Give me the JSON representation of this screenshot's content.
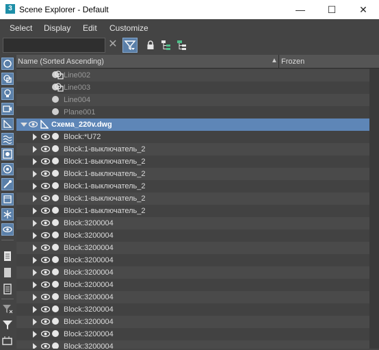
{
  "window": {
    "app_icon": "3",
    "title": "Scene Explorer - Default",
    "minimize": "—",
    "maximize": "☐",
    "close": "✕"
  },
  "menu": [
    "Select",
    "Display",
    "Edit",
    "Customize"
  ],
  "toolbar": {
    "search_value": "",
    "clear_symbol": "✕",
    "icons": [
      "filter-icon",
      "lock-icon",
      "hierarchy-icon",
      "collapse-hierarchy-icon"
    ]
  },
  "sidebar_icons": [
    "geometry-icon",
    "shape-icon",
    "light-icon",
    "camera-icon",
    "helper-icon",
    "spacewarp-icon",
    "group-icon",
    "xref-icon",
    "bone-icon",
    "container-icon",
    "frozen-icon",
    "hidden-icon",
    "display-all-icon",
    "display-none-icon",
    "invert-display-icon",
    "filter-funnel-x-icon",
    "filter-funnel-icon",
    "layer-icon"
  ],
  "columns": {
    "name": "Name (Sorted Ascending)",
    "sort_arrow": "▲",
    "frozen": "Frozen"
  },
  "frozen_symbol": "❄",
  "colors": {
    "background": "#444444",
    "selection": "#5e86b7",
    "active_button": "#5a7fa8"
  },
  "rows": [
    {
      "name": "Line002",
      "type": "line-icon",
      "level": 1,
      "expander": "none",
      "eye": false,
      "dim": true,
      "frozen": true,
      "selected": false
    },
    {
      "name": "Line003",
      "type": "line-icon",
      "level": 1,
      "expander": "none",
      "eye": false,
      "dim": true,
      "frozen": true,
      "selected": false
    },
    {
      "name": "Line004",
      "type": "none",
      "level": 1,
      "expander": "none",
      "eye": false,
      "dim": true,
      "frozen": true,
      "selected": false
    },
    {
      "name": "Plane001",
      "type": "none",
      "level": 1,
      "expander": "none",
      "eye": false,
      "dim": true,
      "frozen": true,
      "selected": false
    },
    {
      "name": "Схема_220v.dwg",
      "type": "xref-icon",
      "level": 0,
      "expander": "open",
      "eye": true,
      "dim": false,
      "frozen": true,
      "selected": true
    },
    {
      "name": "Block:*U72",
      "type": "none",
      "level": 1,
      "expander": "closed",
      "eye": true,
      "dim": false,
      "frozen": true,
      "selected": false
    },
    {
      "name": "Block:1-выключатель_2",
      "type": "none",
      "level": 1,
      "expander": "closed",
      "eye": true,
      "dim": false,
      "frozen": true,
      "selected": false
    },
    {
      "name": "Block:1-выключатель_2",
      "type": "none",
      "level": 1,
      "expander": "closed",
      "eye": true,
      "dim": false,
      "frozen": true,
      "selected": false
    },
    {
      "name": "Block:1-выключатель_2",
      "type": "none",
      "level": 1,
      "expander": "closed",
      "eye": true,
      "dim": false,
      "frozen": true,
      "selected": false
    },
    {
      "name": "Block:1-выключатель_2",
      "type": "none",
      "level": 1,
      "expander": "closed",
      "eye": true,
      "dim": false,
      "frozen": true,
      "selected": false
    },
    {
      "name": "Block:1-выключатель_2",
      "type": "none",
      "level": 1,
      "expander": "closed",
      "eye": true,
      "dim": false,
      "frozen": true,
      "selected": false
    },
    {
      "name": "Block:1-выключатель_2",
      "type": "none",
      "level": 1,
      "expander": "closed",
      "eye": true,
      "dim": false,
      "frozen": true,
      "selected": false
    },
    {
      "name": "Block:3200004",
      "type": "none",
      "level": 1,
      "expander": "closed",
      "eye": true,
      "dim": false,
      "frozen": true,
      "selected": false
    },
    {
      "name": "Block:3200004",
      "type": "none",
      "level": 1,
      "expander": "closed",
      "eye": true,
      "dim": false,
      "frozen": true,
      "selected": false
    },
    {
      "name": "Block:3200004",
      "type": "none",
      "level": 1,
      "expander": "closed",
      "eye": true,
      "dim": false,
      "frozen": true,
      "selected": false
    },
    {
      "name": "Block:3200004",
      "type": "none",
      "level": 1,
      "expander": "closed",
      "eye": true,
      "dim": false,
      "frozen": true,
      "selected": false
    },
    {
      "name": "Block:3200004",
      "type": "none",
      "level": 1,
      "expander": "closed",
      "eye": true,
      "dim": false,
      "frozen": true,
      "selected": false
    },
    {
      "name": "Block:3200004",
      "type": "none",
      "level": 1,
      "expander": "closed",
      "eye": true,
      "dim": false,
      "frozen": true,
      "selected": false
    },
    {
      "name": "Block:3200004",
      "type": "none",
      "level": 1,
      "expander": "closed",
      "eye": true,
      "dim": false,
      "frozen": true,
      "selected": false
    },
    {
      "name": "Block:3200004",
      "type": "none",
      "level": 1,
      "expander": "closed",
      "eye": true,
      "dim": false,
      "frozen": true,
      "selected": false
    },
    {
      "name": "Block:3200004",
      "type": "none",
      "level": 1,
      "expander": "closed",
      "eye": true,
      "dim": false,
      "frozen": true,
      "selected": false
    },
    {
      "name": "Block:3200004",
      "type": "none",
      "level": 1,
      "expander": "closed",
      "eye": true,
      "dim": false,
      "frozen": true,
      "selected": false
    },
    {
      "name": "Block:3200004",
      "type": "none",
      "level": 1,
      "expander": "closed",
      "eye": true,
      "dim": false,
      "frozen": true,
      "selected": false
    }
  ]
}
